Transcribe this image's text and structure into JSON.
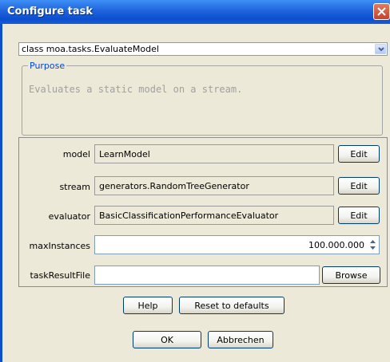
{
  "window": {
    "title": "Configure task"
  },
  "task_select": {
    "value": "class moa.tasks.EvaluateModel"
  },
  "purpose": {
    "legend": "Purpose",
    "text": "Evaluates a static model on a stream."
  },
  "options": [
    {
      "label": "model",
      "value": "LearnModel",
      "button": "Edit"
    },
    {
      "label": "stream",
      "value": "generators.RandomTreeGenerator",
      "button": "Edit"
    },
    {
      "label": "evaluator",
      "value": "BasicClassificationPerformanceEvaluator",
      "button": "Edit"
    },
    {
      "label": "maxInstances",
      "value": "100.000.000"
    },
    {
      "label": "taskResultFile",
      "value": "",
      "button": "Browse"
    }
  ],
  "buttons": {
    "help": "Help",
    "reset": "Reset to defaults",
    "ok": "OK",
    "cancel": "Abbrechen"
  },
  "colors": {
    "titlebar": "#0b4fce",
    "close": "#c7422a",
    "dialog_bg": "#ece9d8",
    "legend": "#0046d5"
  },
  "icons": {
    "close": "close-icon",
    "dropdown": "chevron-down-icon",
    "spinner": "spinner-arrows-icon"
  }
}
